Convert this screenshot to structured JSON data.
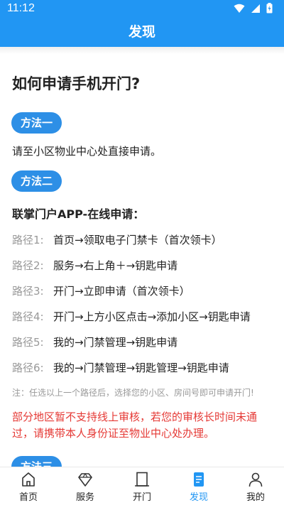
{
  "status_bar": {
    "time": "11:12"
  },
  "header": {
    "title": "发现"
  },
  "main": {
    "heading": "如何申请手机开门?",
    "method1": {
      "label": "方法一",
      "text": "请至小区物业中心处直接申请。"
    },
    "method2": {
      "label": "方法二",
      "subheading": "联掌门户APP-在线申请：",
      "paths": [
        {
          "label": "路径1:",
          "value": "首页→领取电子门禁卡（首次领卡）"
        },
        {
          "label": "路径2:",
          "value": "服务→右上角＋→钥匙申请"
        },
        {
          "label": "路径3:",
          "value": "开门→立即申请（首次领卡）"
        },
        {
          "label": "路径4:",
          "value": "开门→上方小区点击→添加小区→钥匙申请"
        },
        {
          "label": "路径5:",
          "value": "我的→门禁管理→钥匙申请"
        },
        {
          "label": "路径6:",
          "value": "我的→门禁管理→钥匙管理→钥匙申请"
        }
      ],
      "note": "注：任选以上一个路径后，选择您的小区、房间号即可申请开门!",
      "warning": "部分地区暂不支持线上审核，若您的审核长时间未通过，请携带本人身份证至物业中心处办理。"
    },
    "method3": {
      "label": "方法三"
    }
  },
  "tab_bar": {
    "items": [
      {
        "label": "首页",
        "icon": "home-icon"
      },
      {
        "label": "服务",
        "icon": "diamond-icon"
      },
      {
        "label": "开门",
        "icon": "door-icon"
      },
      {
        "label": "发现",
        "icon": "document-icon",
        "active": true
      },
      {
        "label": "我的",
        "icon": "person-icon"
      }
    ]
  },
  "colors": {
    "primary": "#2196f3",
    "pill": "#2d8fe6",
    "warning": "#e53935",
    "muted": "#999999"
  }
}
